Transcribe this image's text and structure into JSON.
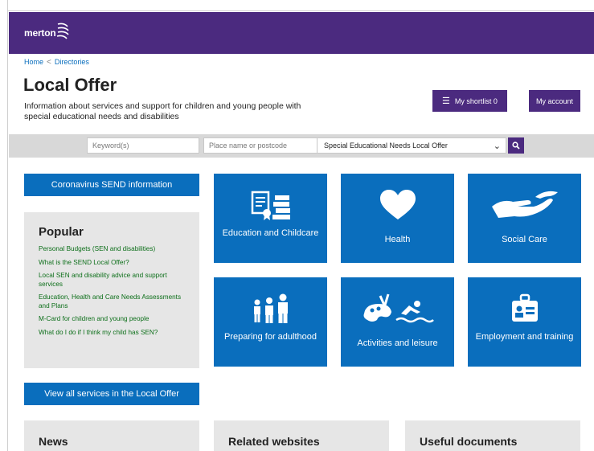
{
  "brand": {
    "logo_text": "merton",
    "accent": "#4b2a7f",
    "tile_color": "#0a6ebd"
  },
  "breadcrumb": {
    "home": "Home",
    "separator": "<",
    "current": "Directories"
  },
  "header": {
    "title": "Local Offer",
    "intro": "Information about services and support for children and young people with special educational needs and disabilities",
    "shortlist_label": "My shortlist 0",
    "account_label": "My account"
  },
  "search": {
    "keyword_placeholder": "Keyword(s)",
    "place_placeholder": "Place name or postcode",
    "directory_selected": "Special Educational Needs Local Offer"
  },
  "left": {
    "covid_button": "Coronavirus SEND information",
    "popular_title": "Popular",
    "popular_links": [
      "Personal Budgets (SEN and disabilities)",
      "What is the SEND Local Offer?",
      "Local SEN and disability advice and support services",
      "Education, Health and Care Needs Assessments and Plans",
      "M-Card for children and young people",
      "What do I do if I think my child has SEN?"
    ],
    "view_all_button": "View all services in the Local Offer"
  },
  "tiles": [
    {
      "label": "Education and Childcare",
      "icon": "education-icon"
    },
    {
      "label": "Health",
      "icon": "heart-icon"
    },
    {
      "label": "Social Care",
      "icon": "helping-hand-icon"
    },
    {
      "label": "Preparing for adulthood",
      "icon": "family-icon"
    },
    {
      "label": "Activities and leisure",
      "icon": "activities-icon"
    },
    {
      "label": "Employment and training",
      "icon": "id-badge-icon"
    }
  ],
  "panels": {
    "news": "News",
    "related": "Related websites",
    "documents": "Useful documents"
  }
}
